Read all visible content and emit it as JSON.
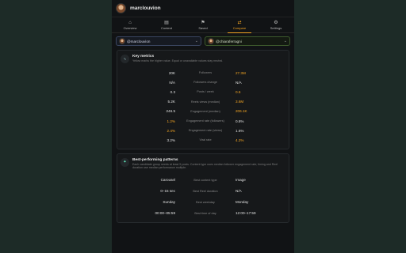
{
  "colors": {
    "accent": "#f5a623",
    "background": "#111315",
    "card": "#16181a",
    "side": "#1d2b27"
  },
  "header": {
    "username": "marclouvion"
  },
  "tabs": [
    {
      "label": "Overview",
      "icon": "overview-icon"
    },
    {
      "label": "Content",
      "icon": "content-icon"
    },
    {
      "label": "Saved",
      "icon": "bookmark-icon"
    },
    {
      "label": "Compare",
      "icon": "compare-icon",
      "active": true
    },
    {
      "label": "Settings",
      "icon": "gear-icon"
    }
  ],
  "compare": {
    "left_account": "@marclouvion",
    "right_account": "@chiaraferragni"
  },
  "key_metrics": {
    "title": "Key metrics",
    "description": "Yellow marks the higher value. Equal or unavailable values stay neutral.",
    "rows": [
      {
        "left": "20K",
        "label": "Followers",
        "right": "27.3M",
        "winner": "right"
      },
      {
        "left": "N/A",
        "label": "Followers change",
        "right": "N/A",
        "winner": "none"
      },
      {
        "left": "0.3",
        "label": "Posts / week",
        "right": "0.6",
        "winner": "right"
      },
      {
        "left": "5.2K",
        "label": "Reels views (median)",
        "right": "3.6M",
        "winner": "right"
      },
      {
        "left": "246.5",
        "label": "Engagement (median)",
        "right": "206.1K",
        "winner": "right"
      },
      {
        "left": "1.2%",
        "label": "Engagement rate (followers)",
        "right": "0.8%",
        "winner": "left"
      },
      {
        "left": "2.4%",
        "label": "Engagement rate (views)",
        "right": "1.6%",
        "winner": "left"
      },
      {
        "left": "3.2%",
        "label": "Viral rate",
        "right": "4.2%",
        "winner": "right"
      }
    ]
  },
  "patterns": {
    "title": "Best-performing patterns",
    "description": "Each candidate group needs at least 5 posts. Content type uses median follower engagement rate; timing and Reel duration use median performance multiple.",
    "rows": [
      {
        "left": "Carousel",
        "label": "Best content type",
        "right": "Image"
      },
      {
        "left": "0–15 sec",
        "label": "Best Reel duration",
        "right": "N/A"
      },
      {
        "left": "Sunday",
        "label": "Best weekday",
        "right": "Monday"
      },
      {
        "left": "00:00–05:59",
        "label": "Best time of day",
        "right": "12:00–17:59"
      }
    ]
  }
}
